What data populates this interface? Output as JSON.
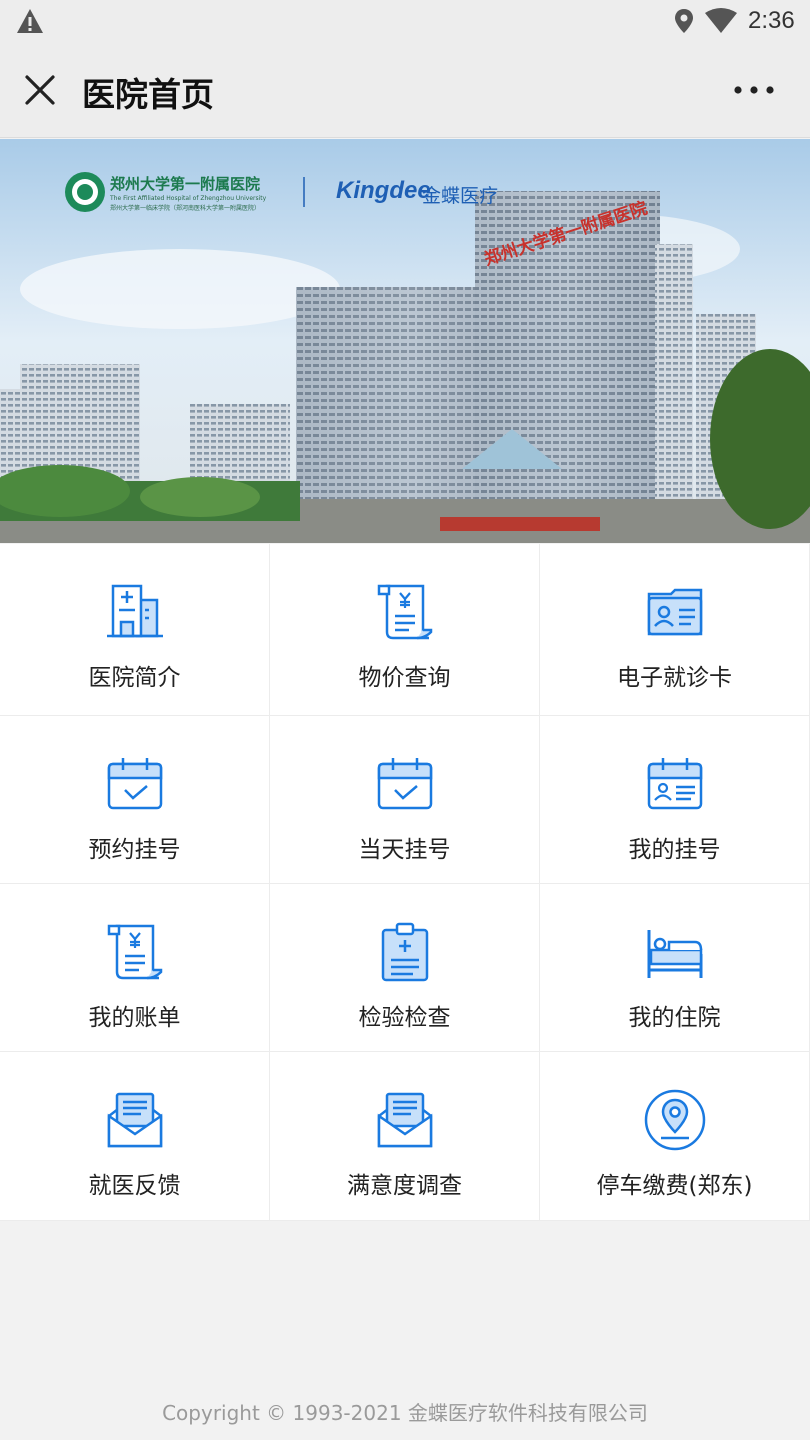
{
  "status_bar": {
    "time": "2:36"
  },
  "nav": {
    "title": "医院首页"
  },
  "banner": {
    "hospital_name": "郑州大学第一附属医院",
    "hospital_en": "The First Affiliated Hospital of Zhengzhou University",
    "hospital_sub": "郑州大学第一临床学院（郑河南医科大学第一附属医院）",
    "brand_en": "Kingdee",
    "brand_cn": "金蝶医疗"
  },
  "menu": [
    {
      "label": "医院简介",
      "icon": "hospital-building-icon"
    },
    {
      "label": "物价查询",
      "icon": "price-scroll-icon"
    },
    {
      "label": "电子就诊卡",
      "icon": "id-card-icon"
    },
    {
      "label": "预约挂号",
      "icon": "calendar-check-icon"
    },
    {
      "label": "当天挂号",
      "icon": "calendar-check-icon"
    },
    {
      "label": "我的挂号",
      "icon": "calendar-person-icon"
    },
    {
      "label": "我的账单",
      "icon": "bill-scroll-icon"
    },
    {
      "label": "检验检查",
      "icon": "clipboard-plus-icon"
    },
    {
      "label": "我的住院",
      "icon": "hospital-bed-icon"
    },
    {
      "label": "就医反馈",
      "icon": "envelope-letter-icon"
    },
    {
      "label": "满意度调查",
      "icon": "envelope-letter-icon"
    },
    {
      "label": "停车缴费(郑东)",
      "icon": "location-pin-icon"
    }
  ],
  "footer": {
    "copyright": "Copyright © 1993-2021 金蝶医疗软件科技有限公司"
  },
  "colors": {
    "accent": "#1a7ae0",
    "icon_fill": "#c7e0fa"
  }
}
